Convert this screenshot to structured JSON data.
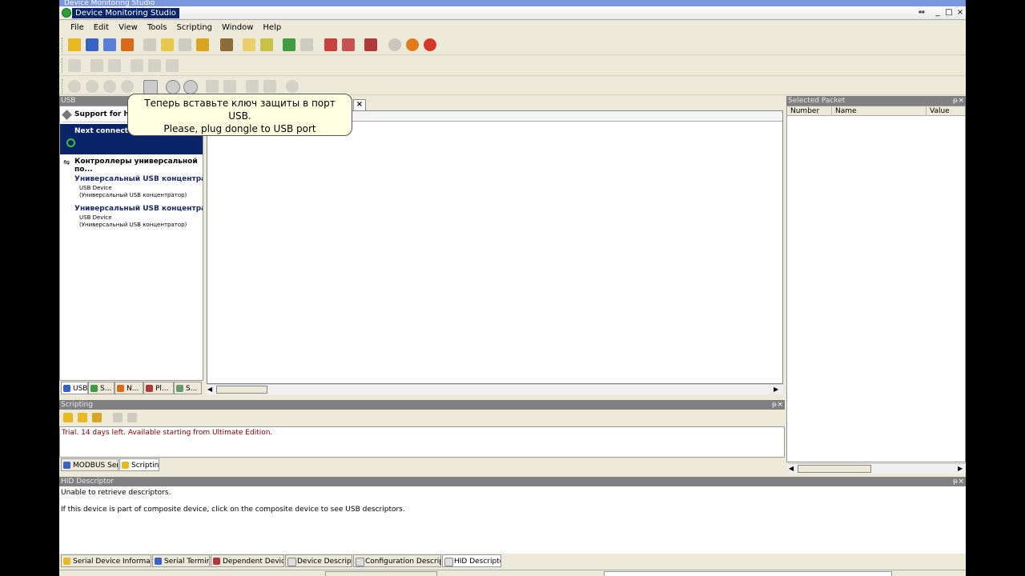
{
  "window": {
    "top_title": "Device Monitoring Studio",
    "title": "Device Monitoring Studio",
    "btn_restore": "⇔",
    "btn_min": "_",
    "btn_max": "□",
    "btn_close": "×"
  },
  "menu": [
    "File",
    "Edit",
    "View",
    "Tools",
    "Scripting",
    "Window",
    "Help"
  ],
  "usb_panel": {
    "header": "USB",
    "support_label": "Support for ho",
    "next_connected": "Next connected",
    "controllers_label": "Контроллеры универсальной по...",
    "devices": [
      {
        "title": "Универсальный USB концентра...",
        "line1": "USB Device",
        "line2": "(Универсальный USB концентратор)"
      },
      {
        "title": "Универсальный USB концентра...",
        "line1": "USB Device",
        "line2": "(Универсальный USB концентратор)"
      }
    ],
    "tabs": [
      "USB",
      "S...",
      "N...",
      "Pl...",
      "S..."
    ]
  },
  "callout": {
    "line1": "Теперь вставьте ключ защиты в порт",
    "line2": "USB.",
    "line3": "Please, plug dongle to USB port",
    "close": "×"
  },
  "selected_packet": {
    "header": "Selected Packet",
    "columns": [
      "Number",
      "Name",
      "Value"
    ]
  },
  "scripting": {
    "header": "Scripting",
    "trial_text": "Trial. 14 days left. Available starting from Ultimate Edition.",
    "tabs": [
      "MODBUS Send",
      "Scripting"
    ]
  },
  "hid": {
    "header": "HID Descriptor",
    "line1": "Unable to retrieve descriptors.",
    "line2": "If this device is part of composite device, click on the composite device to see USB descriptors."
  },
  "bottom_tabs": [
    "Serial Device Information",
    "Serial Terminal",
    "Dependent Devices",
    "Device Descriptor",
    "Configuration Descriptor",
    "HID Descriptor"
  ],
  "colors": {
    "callout_bg": "#ffffe1",
    "selection": "#0a246a",
    "trial_text": "#800000"
  }
}
